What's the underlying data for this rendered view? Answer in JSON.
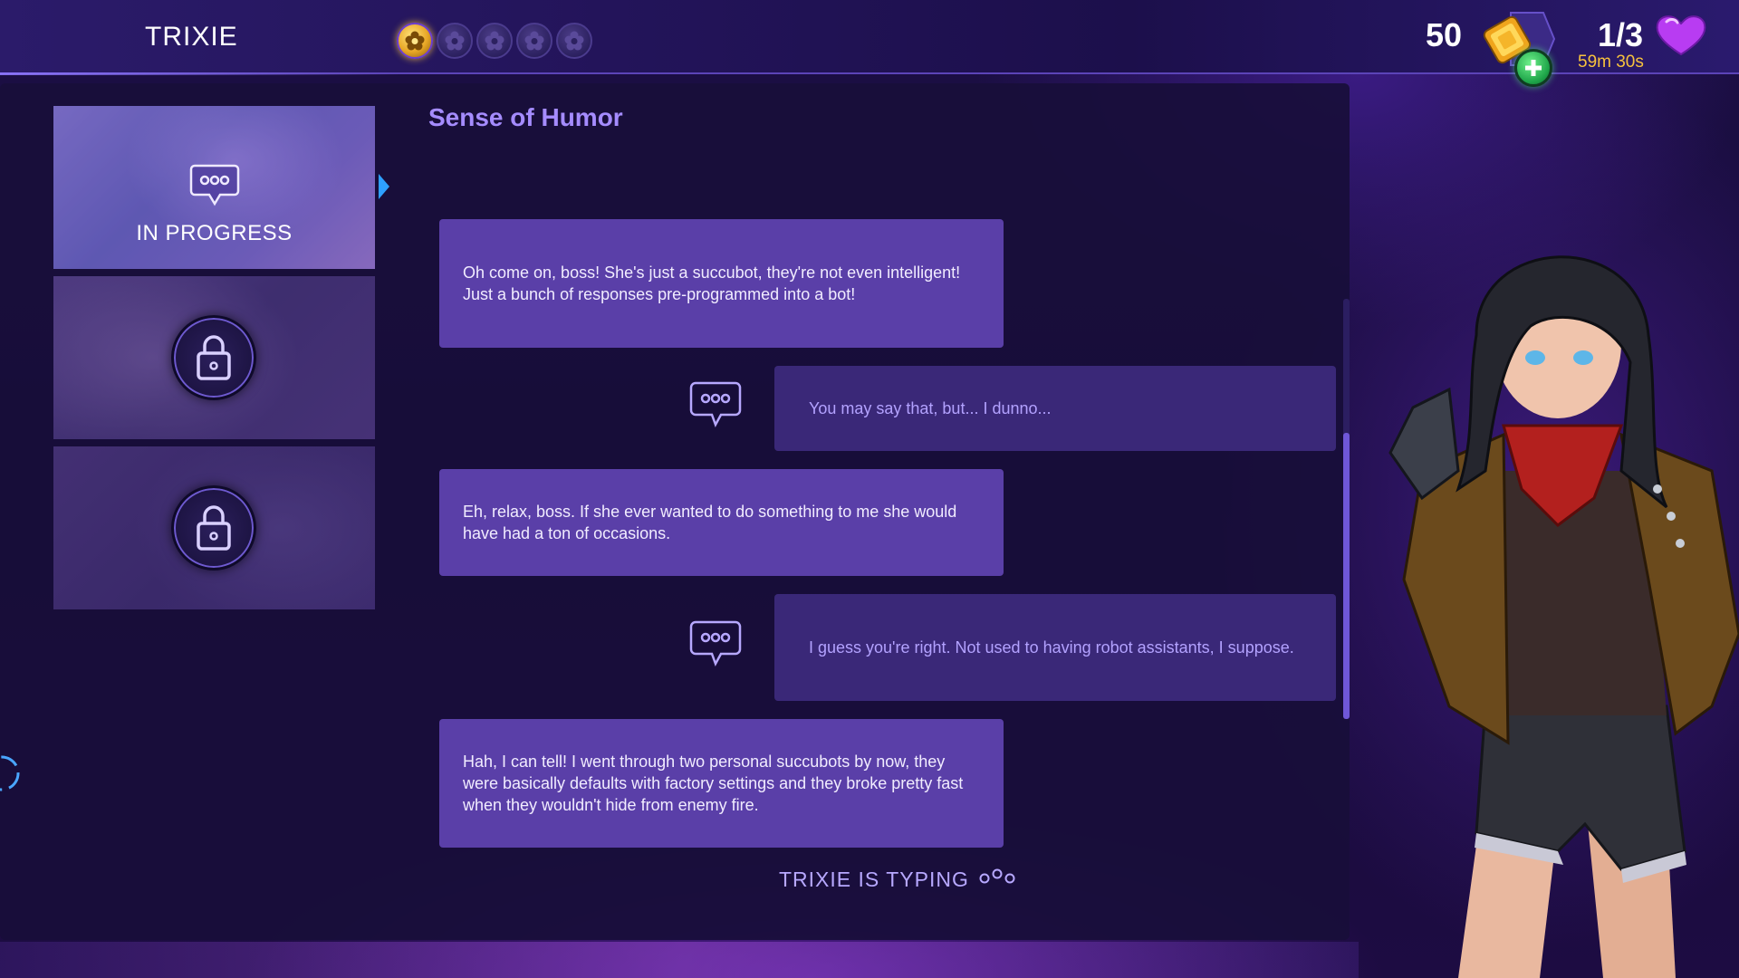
{
  "header": {
    "character_name": "TRIXIE",
    "affection_levels": [
      {
        "state": "filled",
        "icon": "flower-medal-icon"
      },
      {
        "state": "empty",
        "icon": "flower-medal-icon"
      },
      {
        "state": "empty",
        "icon": "flower-medal-icon"
      },
      {
        "state": "empty",
        "icon": "flower-medal-icon"
      },
      {
        "state": "empty",
        "icon": "flower-medal-icon"
      }
    ],
    "gems": "50",
    "hearts": "1/3",
    "hearts_timer": "59m 30s"
  },
  "scenes": [
    {
      "status_label": "IN PROGRESS",
      "state": "in-progress",
      "selected": true
    },
    {
      "status_label": "",
      "state": "locked",
      "selected": false
    },
    {
      "status_label": "",
      "state": "locked",
      "selected": false
    }
  ],
  "chat": {
    "title": "Sense of Humor",
    "messages": [
      {
        "from": "trixie",
        "text": "Oh come on, boss! She's just a succubot, they're not even intelligent! Just a bunch of responses pre-programmed into a bot!"
      },
      {
        "from": "player",
        "text": "You may say that, but... I dunno..."
      },
      {
        "from": "trixie",
        "text": "Eh, relax, boss. If she ever wanted to do something to me she would have had a ton of occasions."
      },
      {
        "from": "player",
        "text": "I guess you're right. Not used to having robot assistants, I suppose."
      },
      {
        "from": "trixie",
        "text": "Hah, I can tell! I went through two personal succubots by now, they were basically defaults with factory settings and they broke pretty fast when they wouldn't hide from enemy fire."
      }
    ],
    "typing_indicator": "TRIXIE  IS TYPING"
  },
  "colors": {
    "accent": "#a58cff",
    "bubble_npc": "#5a3fa8",
    "bubble_player": "#3a2878",
    "gold": "#f7c23d",
    "heart": "#c04cff"
  }
}
